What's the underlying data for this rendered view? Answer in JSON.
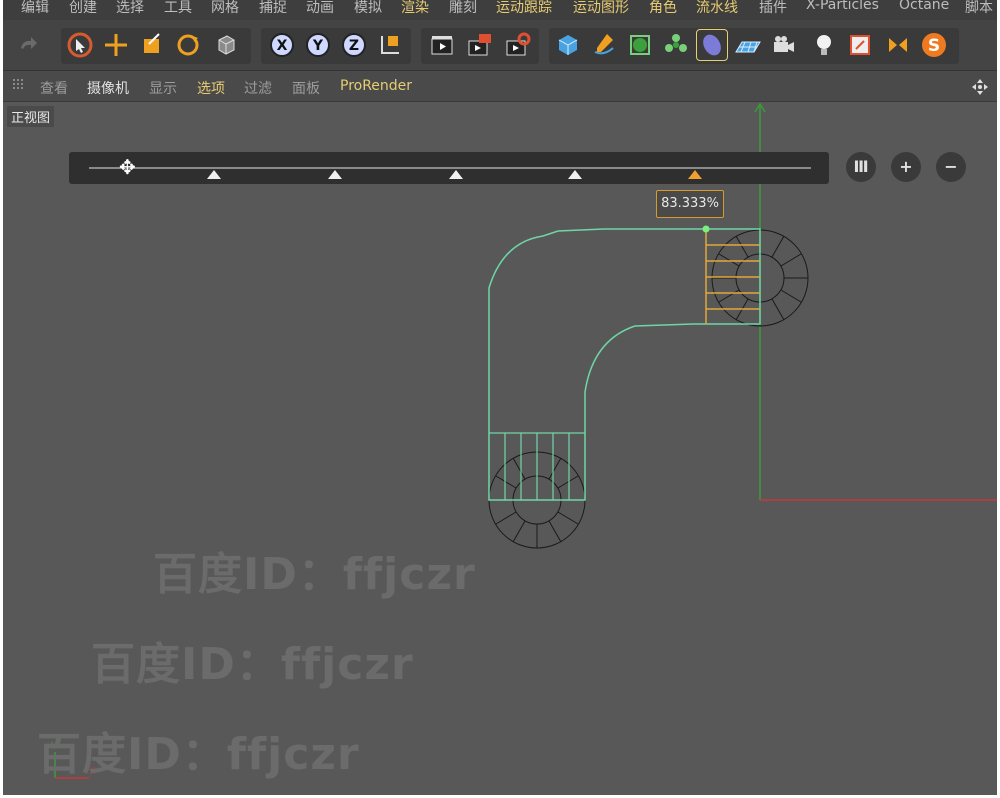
{
  "menu": {
    "items": [
      "编辑",
      "创建",
      "选择",
      "工具",
      "网格",
      "捕捉",
      "动画",
      "模拟",
      "渲染",
      "雕刻",
      "运动跟踪",
      "运动图形",
      "角色",
      "流水线",
      "插件",
      "X-Particles",
      "Octane",
      "脚本"
    ]
  },
  "viewmenu": {
    "items": [
      "查看",
      "摄像机",
      "显示",
      "选项",
      "过滤",
      "面板",
      "ProRender"
    ]
  },
  "viewport": {
    "label": "正视图",
    "percent": "83.333%",
    "active_knot": 5,
    "knot_count": 5
  },
  "slider_buttons": {
    "pause": "Ⅲ",
    "plus": "+",
    "minus": "−"
  },
  "watermarks": [
    "百度ID：ffjczr",
    "百度ID：ffjczr",
    "百度ID：ffjczr"
  ],
  "colors": {
    "spline": "#6fd6a8",
    "highlight": "#e0a83a",
    "axis_y": "#3c9a3c",
    "axis_x": "#c23a3a"
  }
}
